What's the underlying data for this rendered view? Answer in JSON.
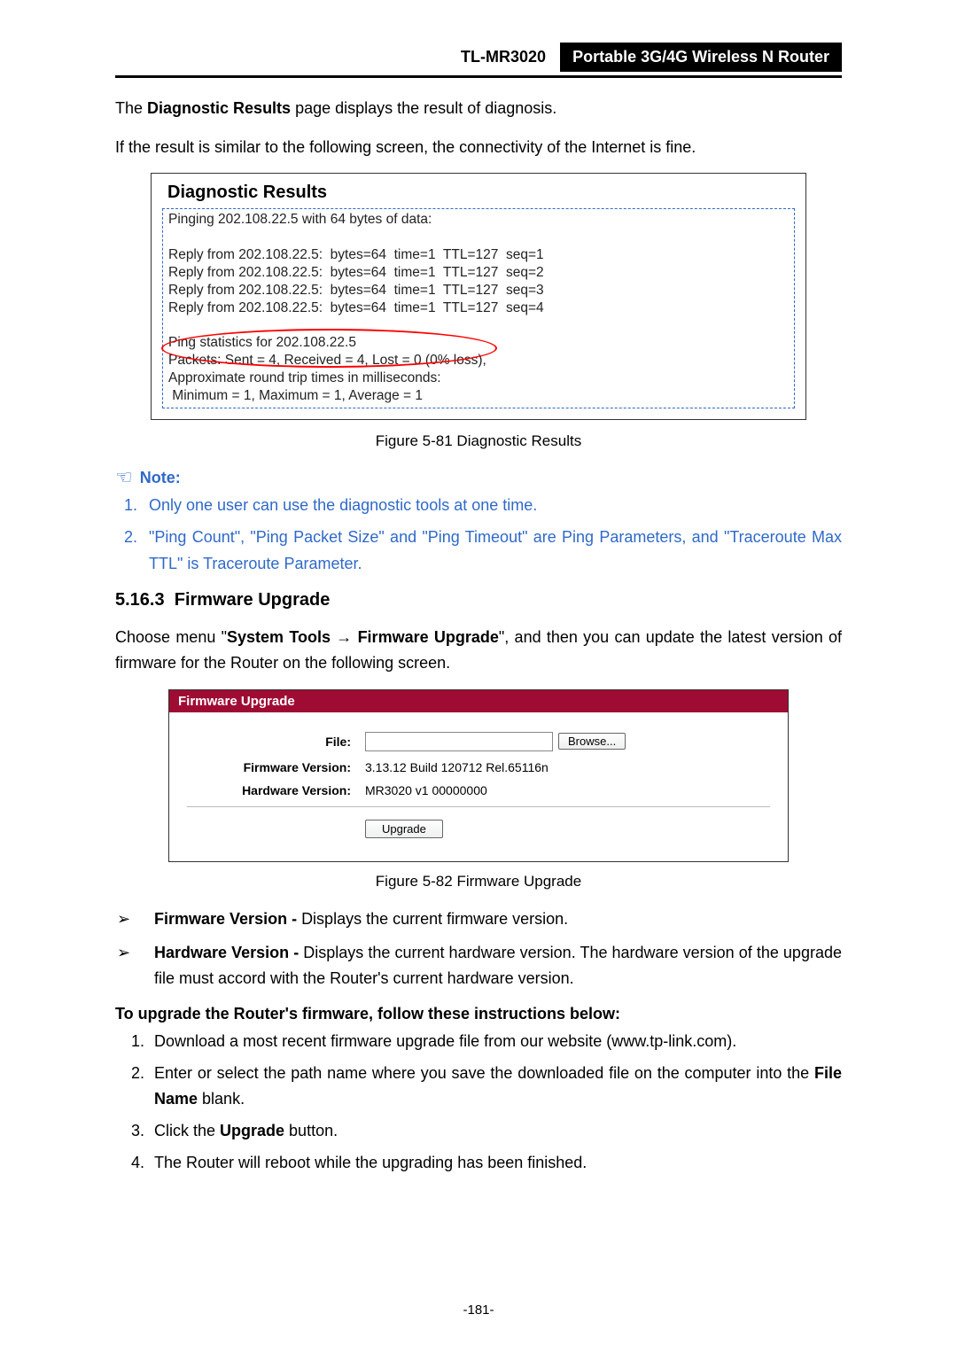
{
  "header": {
    "model": "TL-MR3020",
    "title": "Portable 3G/4G Wireless N Router"
  },
  "intro1_a": "The ",
  "intro1_b": "Diagnostic Results",
  "intro1_c": " page displays the result of diagnosis.",
  "intro2": "If the result is similar to the following screen, the connectivity of the Internet is fine.",
  "diag": {
    "title": "Diagnostic Results",
    "l0": "Pinging 202.108.22.5 with 64 bytes of data:",
    "r1": "Reply from 202.108.22.5:  bytes=64  time=1  TTL=127  seq=1",
    "r2": "Reply from 202.108.22.5:  bytes=64  time=1  TTL=127  seq=2",
    "r3": "Reply from 202.108.22.5:  bytes=64  time=1  TTL=127  seq=3",
    "r4": "Reply from 202.108.22.5:  bytes=64  time=1  TTL=127  seq=4",
    "s1": "Ping statistics for 202.108.22.5",
    "s2": "Packets: Sent = 4, Received = 4, Lost = 0 (0% loss),",
    "s3": "Approximate round trip times in milliseconds:",
    "s4": " Minimum = 1, Maximum = 1, Average = 1"
  },
  "figcap1": "Figure 5-81    Diagnostic Results",
  "noteLabel": "Note:",
  "note1": "Only one user can use the diagnostic tools at one time.",
  "note2": "\"Ping Count\", \"Ping Packet Size\" and \"Ping Timeout\" are Ping Parameters, and \"Traceroute Max TTL\" is Traceroute Parameter.",
  "sectionNum": "5.16.3",
  "sectionTitle": "Firmware Upgrade",
  "choose_a": "Choose menu \"",
  "choose_b": "System Tools",
  "choose_arrow": " → ",
  "choose_c": "Firmware Upgrade",
  "choose_d": "\", and then you can update the latest version of firmware for the Router on the following screen.",
  "fw": {
    "head": "Firmware Upgrade",
    "fileLabel": "File:",
    "browse": "Browse...",
    "fverLabel": "Firmware Version:",
    "fver": "3.13.12 Build 120712 Rel.65116n",
    "hverLabel": "Hardware Version:",
    "hver": "MR3020 v1 00000000",
    "upgrade": "Upgrade"
  },
  "figcap2": "Figure 5-82    Firmware Upgrade",
  "bullet1_b": "Firmware Version - ",
  "bullet1_t": "Displays the current firmware version.",
  "bullet2_b": "Hardware Version - ",
  "bullet2_t": "Displays the current hardware version. The hardware version of the upgrade file must accord with the Router's current hardware version.",
  "instrHead": "To upgrade the Router's firmware, follow these instructions below:",
  "step1": "Download a most recent firmware upgrade file from our website (www.tp-link.com).",
  "step2a": "Enter or select the path name where you save the downloaded file on the computer into the ",
  "step2b": "File Name",
  "step2c": " blank.",
  "step3a": "Click the ",
  "step3b": "Upgrade",
  "step3c": " button.",
  "step4": "The Router will reboot while the upgrading has been finished.",
  "pagenum": "-181-"
}
